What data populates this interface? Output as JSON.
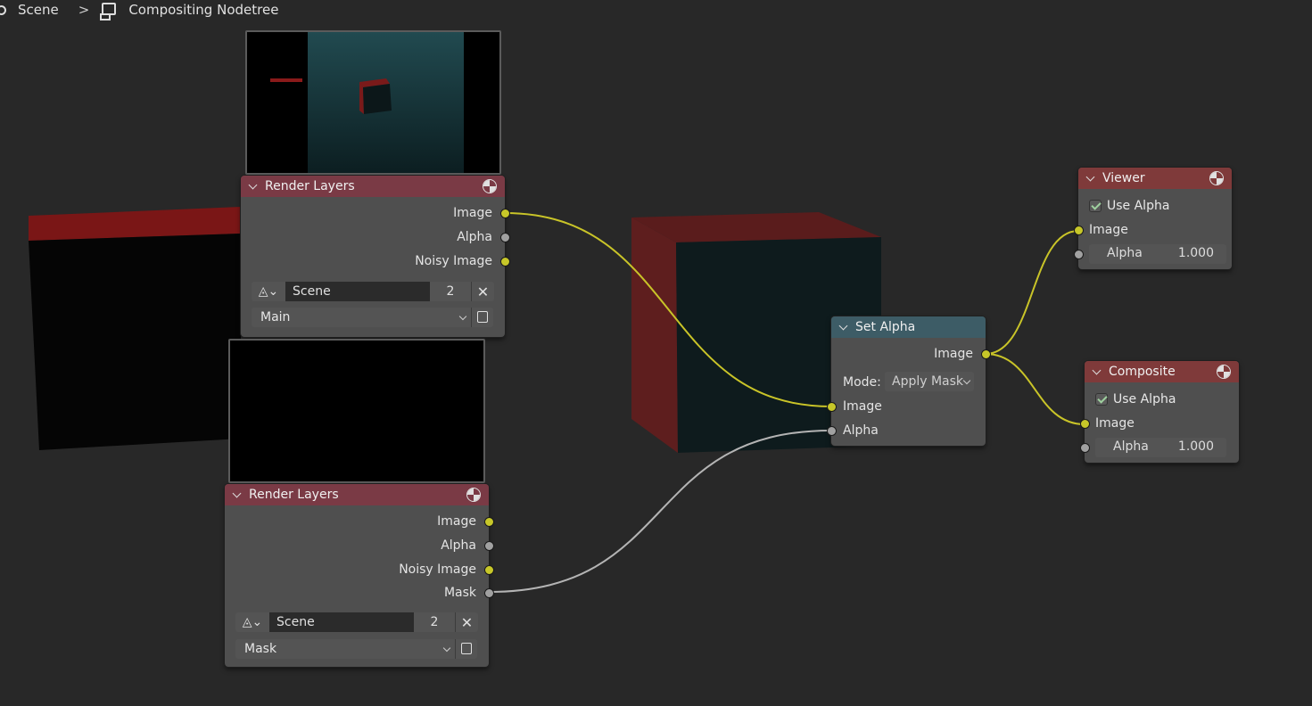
{
  "breadcrumb": {
    "scene": "Scene",
    "nodetree": "Compositing Nodetree"
  },
  "colors": {
    "socket_color": "#c7c729",
    "socket_value": "#a1a1a1",
    "link_color": "#c9c428",
    "link_value": "#b4b4b4"
  },
  "render_layers_1": {
    "title": "Render Layers",
    "outputs": [
      "Image",
      "Alpha",
      "Noisy Image"
    ],
    "scene_name": "Scene",
    "scene_users": "2",
    "layer": "Main"
  },
  "render_layers_2": {
    "title": "Render Layers",
    "outputs": [
      "Image",
      "Alpha",
      "Noisy Image",
      "Mask"
    ],
    "scene_name": "Scene",
    "scene_users": "2",
    "layer": "Mask"
  },
  "set_alpha": {
    "title": "Set Alpha",
    "output": "Image",
    "mode_label": "Mode:",
    "mode_value": "Apply Mask",
    "input_image": "Image",
    "input_alpha": "Alpha"
  },
  "viewer": {
    "title": "Viewer",
    "use_alpha": "Use Alpha",
    "image": "Image",
    "alpha_label": "Alpha",
    "alpha_value": "1.000"
  },
  "composite": {
    "title": "Composite",
    "use_alpha": "Use Alpha",
    "image": "Image",
    "alpha_label": "Alpha",
    "alpha_value": "1.000"
  }
}
